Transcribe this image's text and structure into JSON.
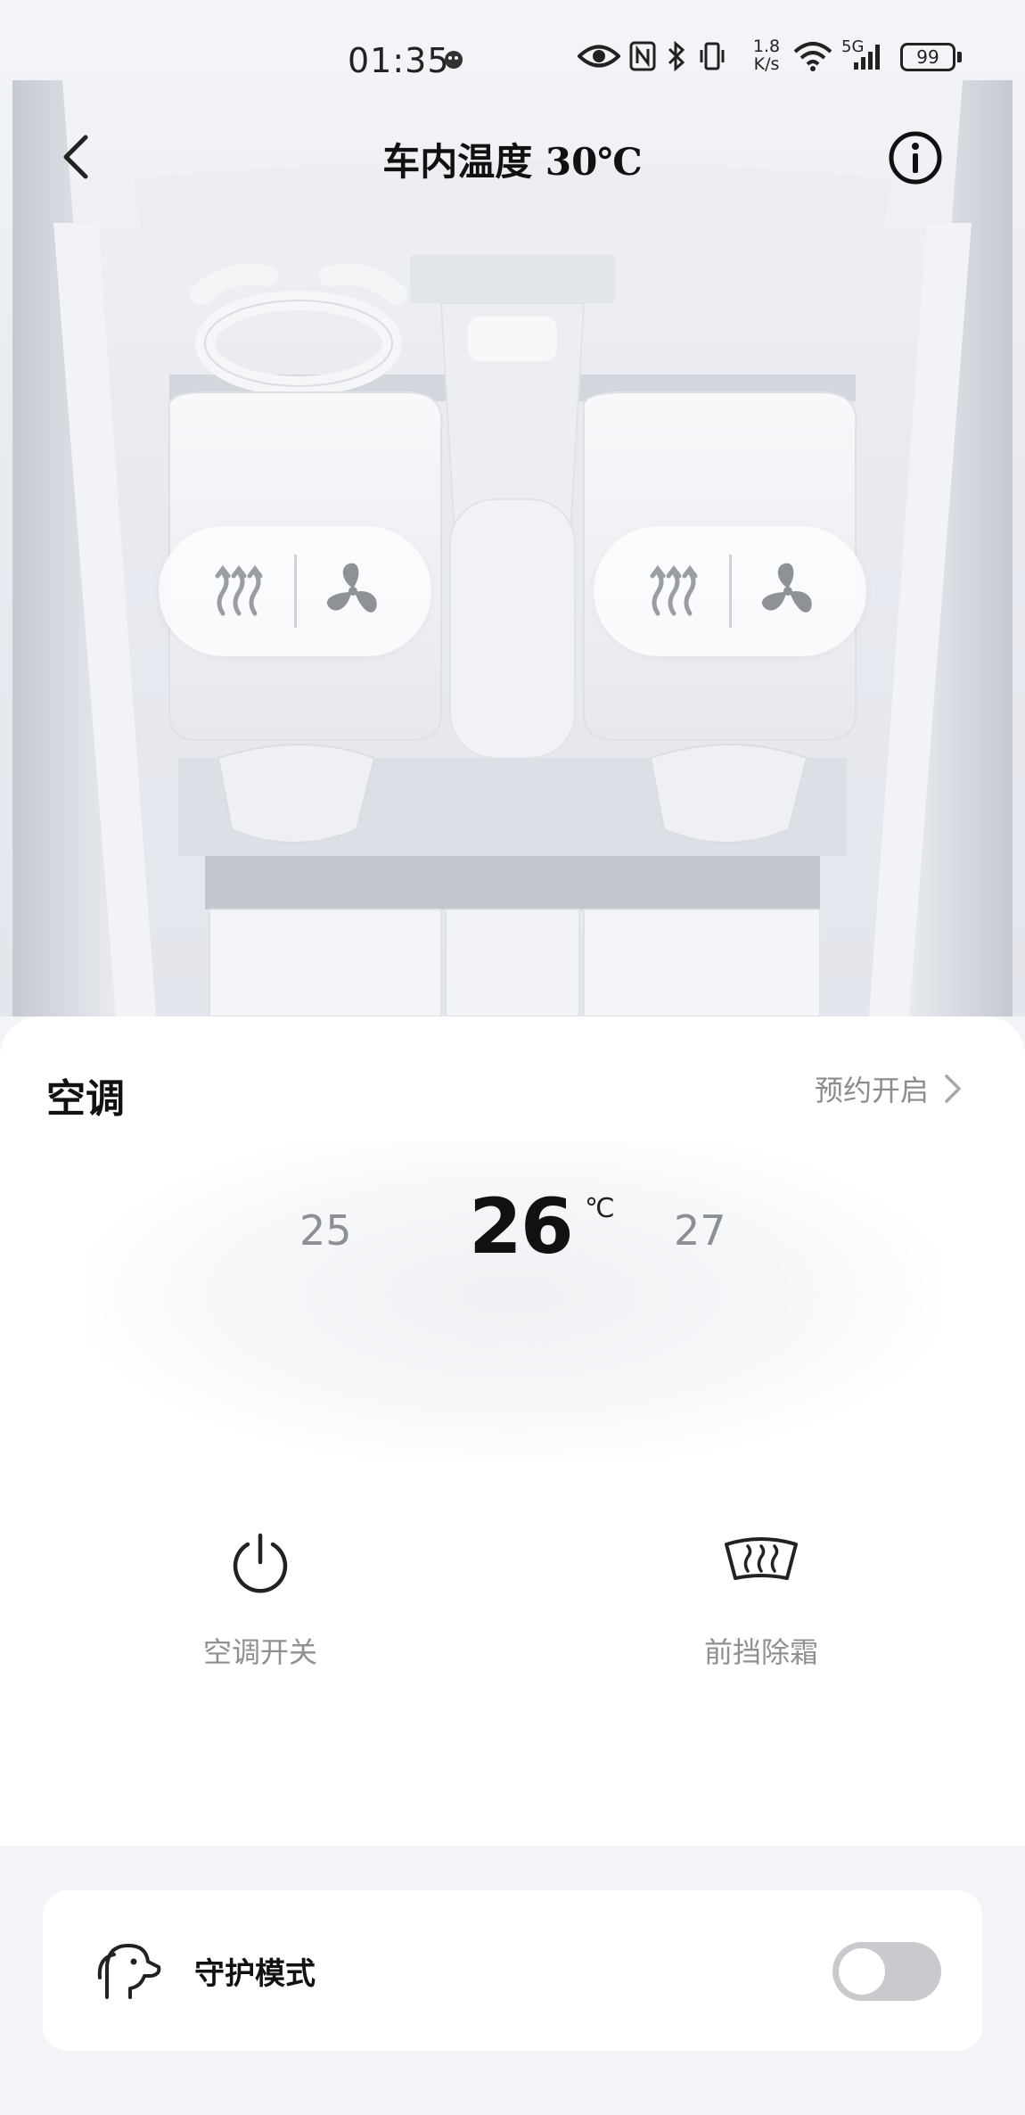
{
  "status_bar": {
    "time": "01:35",
    "network_speed_value": "1.8",
    "network_speed_unit": "K/s",
    "network_type": "5G",
    "battery": "99"
  },
  "header": {
    "title": "车内温度 30℃"
  },
  "seats": {
    "left": {
      "heat_icon": "seat-heat-icon",
      "fan_icon": "seat-fan-icon"
    },
    "right": {
      "heat_icon": "seat-heat-icon",
      "fan_icon": "seat-fan-icon"
    }
  },
  "ac": {
    "title": "空调",
    "schedule_label": "预约开启",
    "temp_prev": "25",
    "temp_current": "26",
    "temp_next": "27",
    "temp_unit": "℃",
    "power_label": "空调开关",
    "defrost_label": "前挡除霜"
  },
  "guard": {
    "label": "守护模式",
    "enabled": false
  },
  "colors": {
    "accent_text": "#111111",
    "muted_text": "#8c8f94",
    "toggle_off": "#c9cacd"
  }
}
